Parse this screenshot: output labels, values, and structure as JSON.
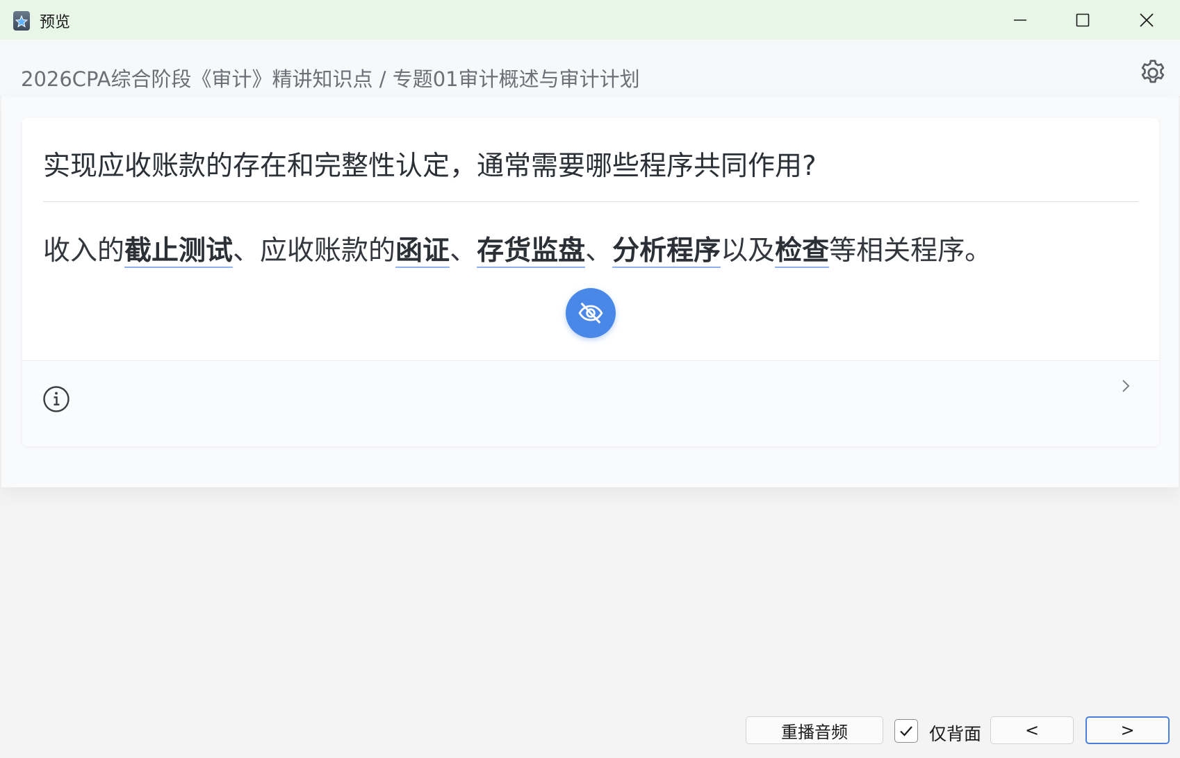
{
  "window": {
    "title": "预览",
    "icons": [
      "app-icon",
      "minimize-icon",
      "maximize-icon",
      "close-icon"
    ]
  },
  "header": {
    "breadcrumb": "2026CPA综合阶段《审计》精讲知识点 / 专题01审计概述与审计计划",
    "settings_icon": "gear-icon"
  },
  "card": {
    "question": "实现应收账款的存在和完整性认定，通常需要哪些程序共同作用?",
    "answer": {
      "p1": "收入的",
      "k1": "截止测试",
      "p2": "、应收账款的",
      "k2": "函证",
      "p3": "、",
      "k3": "存货监盘",
      "p4": "、",
      "k4": "分析程序",
      "p5": "以及",
      "k5": "检查",
      "p6": "等相关程序。"
    },
    "toggle_icon": "eye-off-icon",
    "footer_icons": [
      "info-icon",
      "chevron-right-icon"
    ]
  },
  "controls": {
    "replay_label": "重播音频",
    "back_only_checked": true,
    "back_only_label": "仅背面",
    "prev_label": "<",
    "next_label": ">"
  },
  "colors": {
    "titlebar_bg": "#e8f6e8",
    "accent": "#4a88e8",
    "keyword_underline": "#8fb0ee"
  }
}
